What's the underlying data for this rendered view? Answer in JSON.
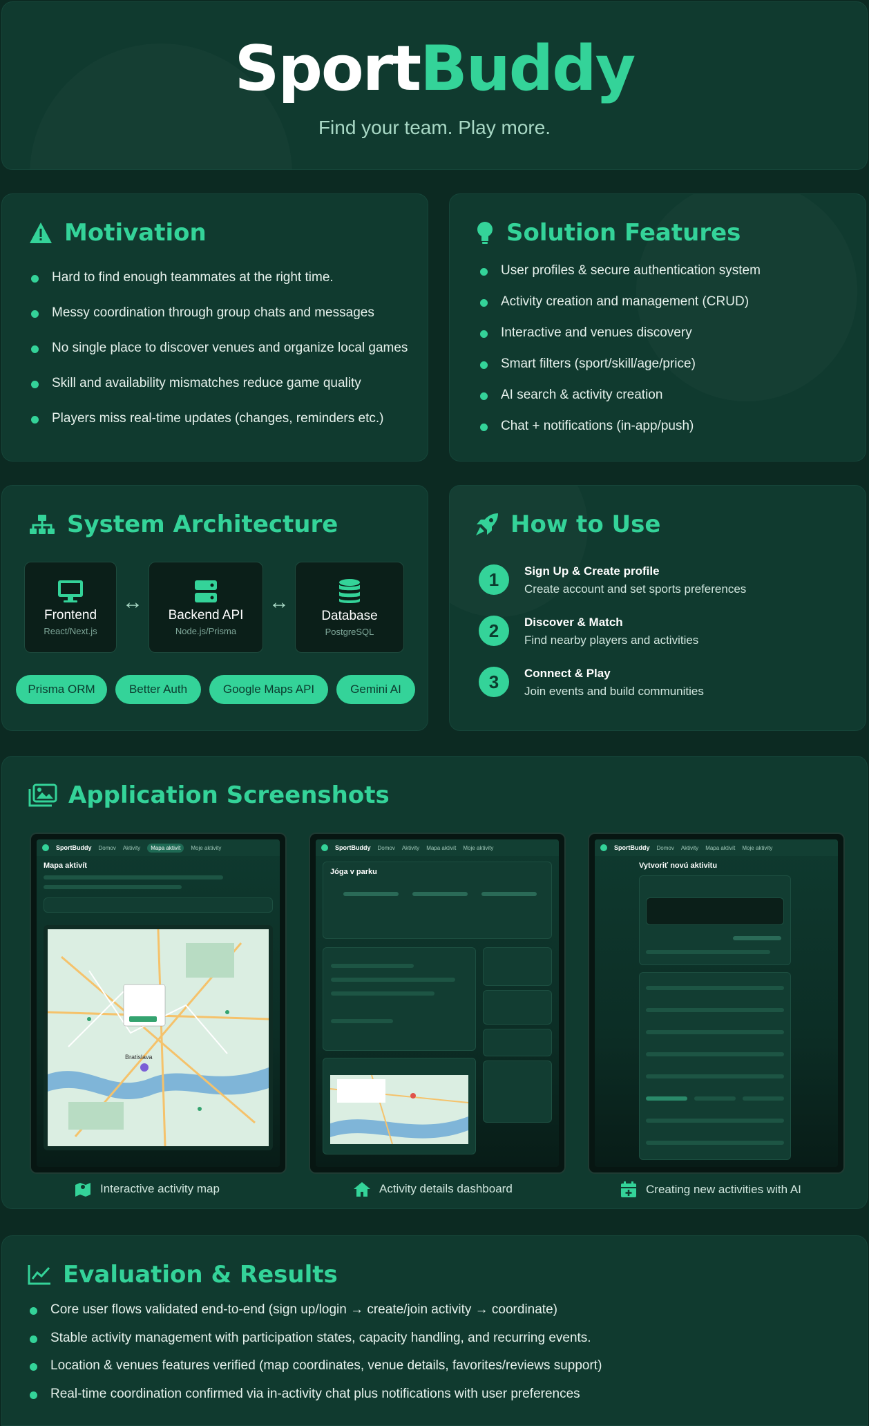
{
  "hero": {
    "title_part1": "Sport",
    "title_part2": "Buddy",
    "subtitle": "Find your team. Play more."
  },
  "motivation": {
    "title": "Motivation",
    "icon": "warning-icon",
    "items": [
      "Hard to find enough teammates at the right time.",
      "Messy coordination through group chats and messages",
      "No single place to discover venues and organize local games",
      "Skill and availability mismatches reduce game quality",
      "Players miss real-time updates (changes, reminders etc.)"
    ]
  },
  "features": {
    "title": "Solution Features",
    "icon": "lightbulb-icon",
    "items": [
      "User profiles & secure authentication system",
      "Activity creation and management (CRUD)",
      "Interactive and venues discovery",
      "Smart filters (sport/skill/age/price)",
      "AI search & activity creation",
      "Chat + notifications (in-app/push)"
    ]
  },
  "architecture": {
    "title": "System Architecture",
    "icon": "sitemap-icon",
    "boxes": [
      {
        "name": "Frontend",
        "tech": "React/Next.js",
        "icon": "monitor-icon"
      },
      {
        "name": "Backend API",
        "tech": "Node.js/Prisma",
        "icon": "server-icon"
      },
      {
        "name": "Database",
        "tech": "PostgreSQL",
        "icon": "database-icon"
      }
    ],
    "arrow": "↔",
    "pills": [
      "Prisma ORM",
      "Better Auth",
      "Google Maps API",
      "Gemini AI"
    ]
  },
  "howto": {
    "title": "How to Use",
    "icon": "rocket-icon",
    "steps": [
      {
        "num": "1",
        "title": "Sign Up & Create profile",
        "desc": "Create account and set sports preferences"
      },
      {
        "num": "2",
        "title": "Discover & Match",
        "desc": "Find nearby players and activities"
      },
      {
        "num": "3",
        "title": "Connect & Play",
        "desc": "Join events and build communities"
      }
    ]
  },
  "screens": {
    "title": "Application Screenshots",
    "icon": "images-icon",
    "app_brand": "SportBuddy",
    "nav": [
      "Domov",
      "Aktivity",
      "Mapa aktivít",
      "Moje aktivity"
    ],
    "shots": [
      {
        "heading": "Mapa aktivít",
        "caption": "Interactive activity map",
        "caption_icon": "map-icon"
      },
      {
        "heading": "Jóga v parku",
        "caption": "Activity details dashboard",
        "caption_icon": "home-icon"
      },
      {
        "heading": "Vytvoriť novú aktivitu",
        "caption": "Creating new activities with AI",
        "caption_icon": "calendar-plus-icon"
      }
    ],
    "map_label": "Bratislava"
  },
  "evaluation": {
    "title": "Evaluation & Results",
    "icon": "chart-line-icon",
    "items": [
      "Core user flows validated end-to-end (sign up/login → create/join activity → coordinate)",
      "Stable activity management with participation states, capacity handling, and recurring events.",
      "Location & venues features verified (map coordinates, venue details, favorites/reviews support)",
      "Real-time coordination confirmed via in-activity chat plus notifications with user preferences"
    ]
  },
  "colors": {
    "background": "#0c2a22",
    "card": "#103a2f",
    "accent": "#34d399"
  }
}
